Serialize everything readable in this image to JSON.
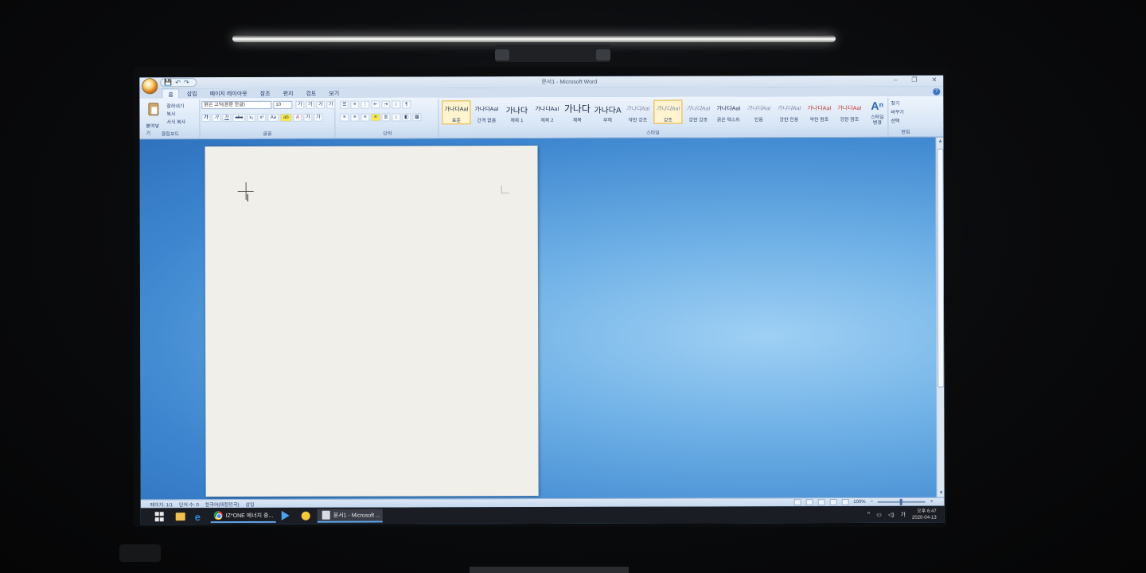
{
  "window": {
    "title": "문서1 - Microsoft Word",
    "controls": [
      "–",
      "❐",
      "✕"
    ],
    "qat": [
      "💾",
      "↶",
      "↷"
    ]
  },
  "tabs": [
    "홈",
    "삽입",
    "페이지 레이아웃",
    "참조",
    "편지",
    "검토",
    "보기"
  ],
  "ribbon": {
    "clipboard": {
      "paste": "붙여넣기",
      "cut": "잘라내기",
      "copy": "복사",
      "format_painter": "서식 복사",
      "label": "클립보드"
    },
    "font": {
      "name": "맑은 고딕(본문 한글)",
      "size": "10",
      "row1": [
        "가",
        "가",
        "가",
        "가",
        "가",
        "가"
      ],
      "row2": [
        "가",
        "가",
        "가",
        "abc",
        "x₂",
        "x²",
        "Aa",
        "ab",
        "A",
        "가",
        "가"
      ],
      "label": "글꼴"
    },
    "paragraph": {
      "label": "단락"
    },
    "styles": {
      "items": [
        {
          "sample": "가나다AaI",
          "name": "표준"
        },
        {
          "sample": "가나다AaI",
          "name": "간격 없음"
        },
        {
          "sample": "가나다",
          "name": "제목 1"
        },
        {
          "sample": "가나다AaI",
          "name": "제목 2"
        },
        {
          "sample": "가나다",
          "name": "제목"
        },
        {
          "sample": "가나다A",
          "name": "부제"
        },
        {
          "sample": "가나다AaI",
          "name": "약한 강조"
        },
        {
          "sample": "가나다AaI",
          "name": "강조"
        },
        {
          "sample": "가나다AaI",
          "name": "강한 강조"
        },
        {
          "sample": "가나다AaI",
          "name": "굵은 텍스트"
        },
        {
          "sample": "가나다AaI",
          "name": "인용"
        },
        {
          "sample": "가나다AaI",
          "name": "강한 인용"
        },
        {
          "sample": "가나다AaI",
          "name": "약한 참조"
        },
        {
          "sample": "가나다AaI",
          "name": "강한 참조"
        }
      ],
      "selected_index": 0,
      "label": "스타일"
    },
    "change_styles": "스타일 변경",
    "editing": {
      "find": "찾기",
      "replace": "바꾸기",
      "select": "선택",
      "label": "편집"
    }
  },
  "statusbar": {
    "page": "페이지: 1/1",
    "words": "단어 수: 0",
    "language": "한국어(대한민국)",
    "mode": "삽입",
    "zoom": "100%"
  },
  "taskbar": {
    "chrome_label": "IZ*ONE 에너지 충...",
    "word_label": "문서1 - Microsoft ...",
    "time": "오후 6:47",
    "date": "2020-04-13",
    "ime": "가"
  },
  "colors": {
    "ribbon_top": "#eef4fc",
    "workspace": "#4e94d8",
    "taskbar": "#1b1d24",
    "selected_style": "#e6b33a"
  }
}
